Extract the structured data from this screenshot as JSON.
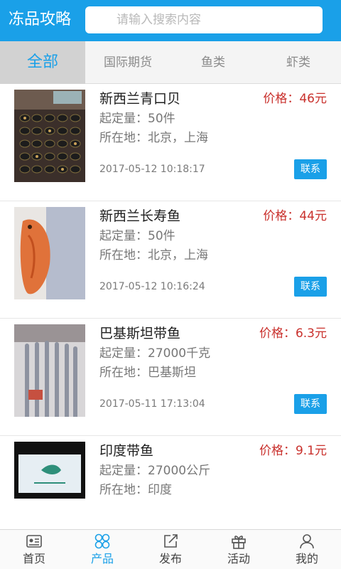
{
  "header": {
    "title": "冻品攻略",
    "search_placeholder": "请输入搜索内容"
  },
  "tabs": [
    {
      "label": "全部",
      "active": true
    },
    {
      "label": "国际期货",
      "active": false
    },
    {
      "label": "鱼类",
      "active": false
    },
    {
      "label": "虾类",
      "active": false
    }
  ],
  "products": [
    {
      "name": "新西兰青口贝",
      "price_label": "价格：",
      "price": "46元",
      "moq": "起定量：50件",
      "location": "所在地：北京，上海",
      "time": "2017-05-12 10:18:17",
      "contact_label": "联系"
    },
    {
      "name": "新西兰长寿鱼",
      "price_label": "价格：",
      "price": "44元",
      "moq": "起定量：50件",
      "location": "所在地：北京，上海",
      "time": "2017-05-12 10:16:24",
      "contact_label": "联系"
    },
    {
      "name": "巴基斯坦带鱼",
      "price_label": "价格：",
      "price": "6.3元",
      "moq": "起定量：27000千克",
      "location": "所在地：巴基斯坦",
      "time": "2017-05-11 17:13:04",
      "contact_label": "联系"
    },
    {
      "name": "印度带鱼",
      "price_label": "价格：",
      "price": "9.1元",
      "moq": "起定量：27000公斤",
      "location": "所在地：印度",
      "time": "",
      "contact_label": ""
    }
  ],
  "nav": [
    {
      "label": "首页",
      "icon": "home-icon",
      "active": false
    },
    {
      "label": "产品",
      "icon": "products-icon",
      "active": true
    },
    {
      "label": "发布",
      "icon": "publish-icon",
      "active": false
    },
    {
      "label": "活动",
      "icon": "gift-icon",
      "active": false
    },
    {
      "label": "我的",
      "icon": "user-icon",
      "active": false
    }
  ],
  "colors": {
    "primary": "#1aa0e8",
    "price": "#c9302c",
    "tab_active_bg": "#d2d2d2"
  }
}
